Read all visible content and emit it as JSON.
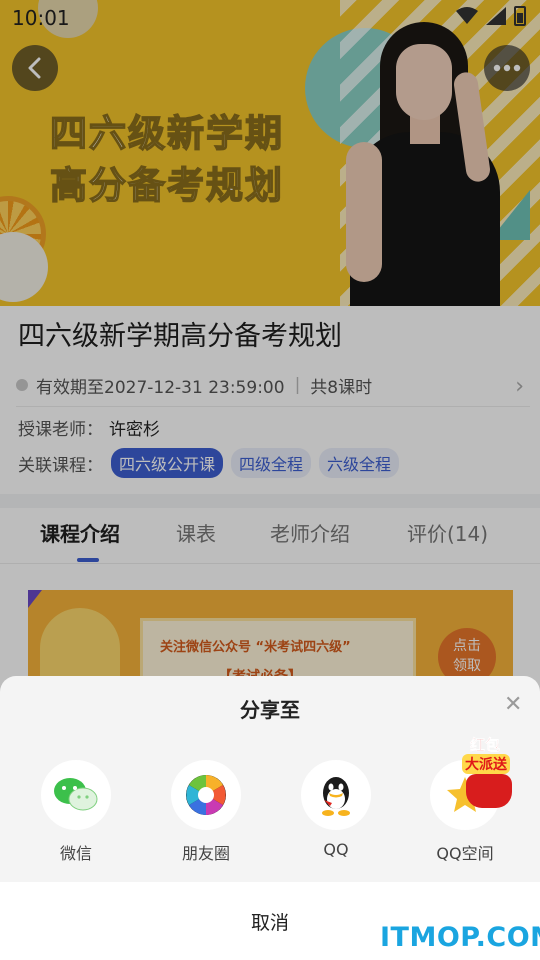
{
  "status_bar": {
    "time": "10:01"
  },
  "hero": {
    "title_line1": "四六级新学期",
    "title_line2": "高分备考规划"
  },
  "course": {
    "title": "四六级新学期高分备考规划",
    "validity": "有效期至2027-12-31 23:59:00",
    "lessons": "共8课时",
    "teacher_label": "授课老师：",
    "teacher_name": "许密杉",
    "related_label": "关联课程：",
    "related_courses": [
      {
        "label": "四六级公开课",
        "active": true
      },
      {
        "label": "四级全程",
        "active": false
      },
      {
        "label": "六级全程",
        "active": false
      }
    ]
  },
  "tabs": [
    {
      "label": "课程介绍",
      "active": true
    },
    {
      "label": "课表",
      "active": false
    },
    {
      "label": "老师介绍",
      "active": false
    },
    {
      "label": "评价(14)",
      "active": false
    }
  ],
  "promo": {
    "line1": "关注微信公众号 “米考试四六级”",
    "line2": "【考试必备】",
    "badge_line1": "点击",
    "badge_line2": "领取"
  },
  "share_sheet": {
    "title": "分享至",
    "targets": [
      {
        "label": "微信",
        "icon": "wechat-icon"
      },
      {
        "label": "朋友圈",
        "icon": "moments-icon"
      },
      {
        "label": "QQ",
        "icon": "qq-icon"
      },
      {
        "label": "QQ空间",
        "icon": "qzone-icon"
      }
    ],
    "cancel": "取消"
  },
  "red_packet": {
    "line1": "红包",
    "line2": "大派送"
  },
  "watermark": "ITMOP.COM",
  "colors": {
    "accent": "#3d5fd1",
    "hero_bg": "#f5c52a",
    "watermark": "#1aa5e0"
  }
}
